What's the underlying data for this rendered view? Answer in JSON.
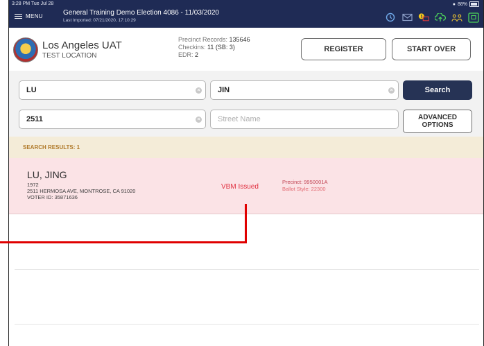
{
  "status_bar": {
    "time": "3:28 PM  Tue Jul 28",
    "battery": "88%",
    "battery_level": 0.88
  },
  "header": {
    "menu_label": "MENU",
    "election_title": "General Training  Demo Election 4086 - 11/03/2020",
    "last_imported": "Last Imported: 07/21/2020, 17:10:29",
    "icons": [
      "history-icon",
      "mail-icon",
      "alert-printer-icon",
      "cloud-upload-icon",
      "users-icon",
      "display-icon"
    ]
  },
  "location": {
    "name": "Los Angeles UAT",
    "sub": "TEST LOCATION",
    "precinct_records_label": "Precinct Records:",
    "precinct_records_value": "135646",
    "checkins_label": "Checkins:",
    "checkins_value": "11 (SB: 3)",
    "edr_label": "EDR:",
    "edr_value": "2",
    "register_label": "REGISTER",
    "start_over_label": "START OVER"
  },
  "search": {
    "last_name": "LU",
    "first_name": "JIN",
    "house_number": "2511",
    "street_placeholder": "Street Name",
    "search_label": "Search",
    "advanced_label_1": "ADVANCED",
    "advanced_label_2": "OPTIONS"
  },
  "results": {
    "header": "SEARCH RESULTS: 1",
    "items": [
      {
        "name": "LU, JING",
        "year": "1972",
        "address": "2511 HERMOSA AVE, MONTROSE, CA 91020",
        "voter_id": "VOTER ID: 35871636",
        "status": "VBM Issued",
        "precinct": "Precinct: 9950001A",
        "ballot_style": "Ballot Style: 22300"
      }
    ]
  },
  "colors": {
    "header_bg": "#1f2b55",
    "result_bg": "#fbe3e6",
    "status_red": "#e03040",
    "callout": "#e00000"
  }
}
